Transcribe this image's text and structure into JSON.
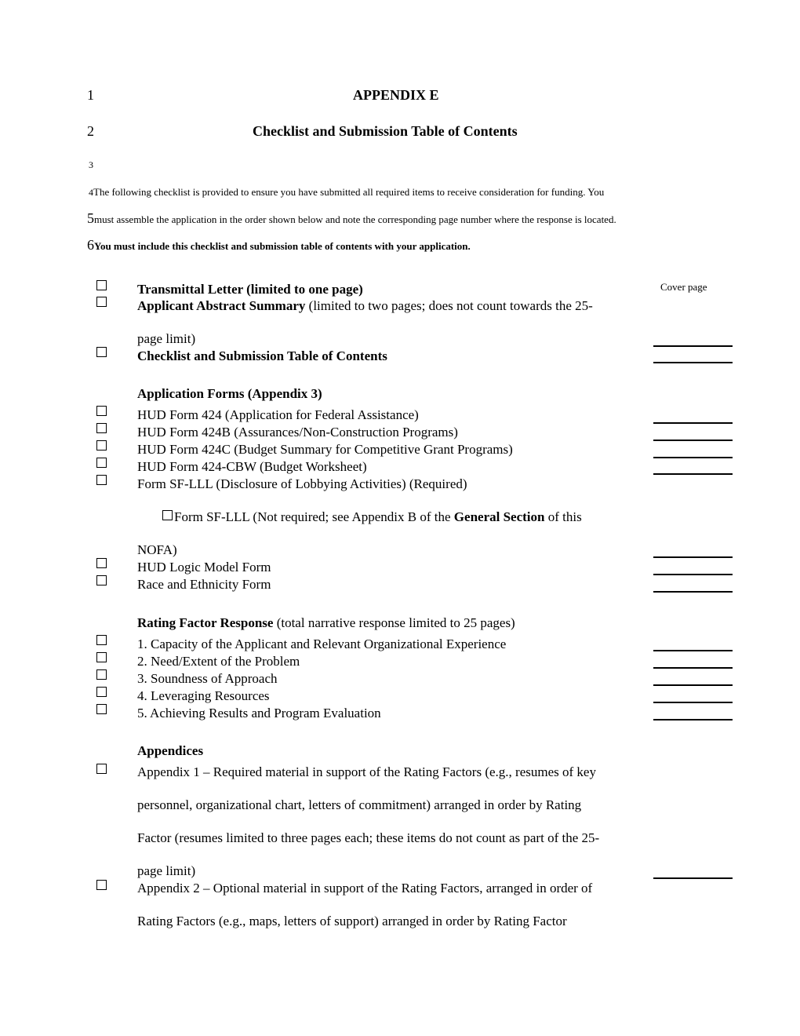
{
  "header": {
    "line_numbers": [
      "1",
      "2",
      "3",
      "4",
      "5",
      "6"
    ],
    "title": "APPENDIX E",
    "subtitle": "Checklist and Submission Table of Contents"
  },
  "intro": {
    "line4": "The following checklist is provided to ensure you have submitted all required items to receive consideration for funding. You",
    "line5": "must assemble the application in the order shown below and note the corresponding page number where the response is located.",
    "line6": "You must include this checklist and submission table of contents with your application."
  },
  "checklist": {
    "transmittal": {
      "label": "Transmittal Letter (limited to one page)",
      "page": "Cover page"
    },
    "abstract": {
      "label_bold": "Applicant Abstract Summary",
      "label_rest": " (limited to two pages; does not count towards the 25-",
      "label_cont": "page limit)"
    },
    "toc": {
      "label": "Checklist and Submission Table of Contents"
    },
    "forms_heading": "Application Forms (Appendix 3)",
    "forms": [
      "HUD Form 424 (Application for Federal Assistance)",
      "HUD Form 424B (Assurances/Non-Construction Programs)",
      "HUD Form 424C (Budget Summary for Competitive Grant Programs)",
      "HUD Form 424-CBW (Budget Worksheet)",
      "Form SF-LLL (Disclosure of Lobbying Activities) (Required)"
    ],
    "sflll_not_required": {
      "pre": "Form SF-LLL (Not required; see Appendix B of the ",
      "bold": "General Section",
      "post": " of this",
      "cont": "NOFA)"
    },
    "forms2": [
      "HUD Logic Model Form",
      "Race and Ethnicity Form"
    ],
    "rating_heading_bold": "Rating Factor Response",
    "rating_heading_rest": " (total narrative response limited to 25 pages)",
    "rating_factors": [
      "1. Capacity of the Applicant and Relevant Organizational Experience",
      "2. Need/Extent of the Problem",
      "3. Soundness of Approach",
      "4. Leveraging Resources",
      "5. Achieving Results and Program Evaluation"
    ],
    "appendices_heading": "Appendices",
    "appendix1": [
      "Appendix 1 – Required material in support of the Rating Factors (e.g., resumes of key",
      "personnel, organizational chart, letters of commitment) arranged in order by Rating",
      "Factor (resumes limited to three pages each; these items do not count as part of the 25-",
      "page limit)"
    ],
    "appendix2": [
      "Appendix 2 – Optional material in support of the Rating Factors, arranged in order of",
      "Rating Factors (e.g., maps, letters of support) arranged in order by Rating Factor"
    ]
  }
}
